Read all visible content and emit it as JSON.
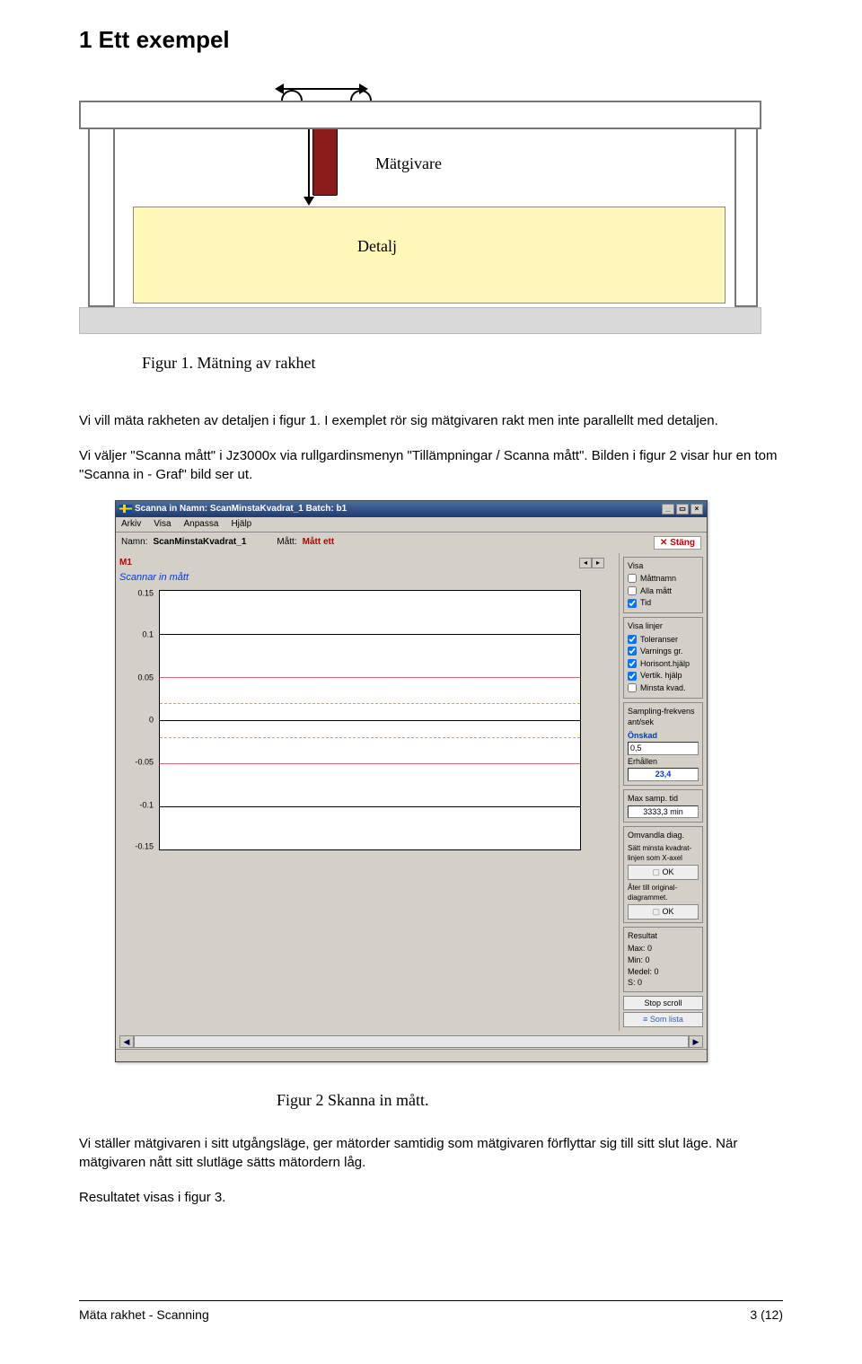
{
  "heading": "1   Ett exempel",
  "diagram": {
    "sensor_label": "Mätgivare",
    "detail_label": "Detalj"
  },
  "fig1_caption": "Figur 1. Mätning av rakhet",
  "para1": "Vi vill mäta rakheten av detaljen i figur 1. I exemplet  rör sig mätgivaren rakt men inte parallellt med detaljen.",
  "para2": "Vi väljer \"Scanna mått\" i Jz3000x via rullgardinsmenyn \"Tillämpningar / Scanna mått\". Bilden i figur 2 visar hur en tom \"Scanna in - Graf\" bild ser ut.",
  "app": {
    "title": "Scanna in   Namn: ScanMinstaKvadrat_1   Batch: b1",
    "menubar": [
      "Arkiv",
      "Visa",
      "Anpassa",
      "Hjälp"
    ],
    "name_label": "Namn:",
    "name_value": "ScanMinstaKvadrat_1",
    "measure_label": "Mått:",
    "measure_value": "Mått ett",
    "close_btn": "Stäng",
    "m1": "M1",
    "scan_label": "Scannar in mått",
    "visa": {
      "title": "Visa",
      "items": [
        "Måttnamn",
        "Alla mått",
        "Tid"
      ]
    },
    "visa_linjer": {
      "title": "Visa linjer",
      "items": [
        "Toleranser",
        "Varnings gr.",
        "Horisont.hjälp",
        "Vertik. hjälp",
        "Minsta kvad."
      ]
    },
    "sampling": {
      "title": "Sampling-frekvens ant/sek",
      "onskad": "Önskad",
      "onskad_val": "0,5",
      "erhallen": "Erhållen",
      "erhallen_val": "23,4"
    },
    "maxsamp": {
      "label": "Max samp. tid",
      "val": "3333,3 min"
    },
    "omvandla": {
      "title": "Omvandla diag.",
      "text": "Sätt minsta kvadrat-linjen som X-axel",
      "ok": "OK",
      "back_title": "Åter till original-diagrammet.",
      "back_ok": "OK"
    },
    "resultat": {
      "title": "Resultat",
      "rows": [
        "Max: 0",
        "Min: 0",
        "Medel: 0",
        "S: 0"
      ]
    },
    "stop_scroll": "Stop scroll",
    "som_lista": "Som lista"
  },
  "chart_data": {
    "type": "line",
    "title": "",
    "xlabel": "",
    "ylabel": "",
    "ylim": [
      -0.15,
      0.15
    ],
    "yticks": [
      0.15,
      0.1,
      0.05,
      0.0,
      -0.05,
      -0.1,
      -0.15
    ],
    "tolerance_lines": [
      0.05,
      -0.05
    ],
    "warning_lines": [
      0.02,
      -0.02
    ],
    "series": [
      {
        "name": "M1",
        "values": []
      }
    ]
  },
  "fig2_caption": "Figur 2 Skanna in mått.",
  "para3": "Vi ställer mätgivaren i sitt utgångsläge, ger mätorder samtidig som mätgivaren förflyttar sig till sitt slut läge. När mätgivaren nått sitt slutläge sätts mätordern låg.",
  "para4": "Resultatet visas  i figur 3.",
  "footer_left": "Mäta rakhet - Scanning",
  "footer_right": "3 (12)"
}
